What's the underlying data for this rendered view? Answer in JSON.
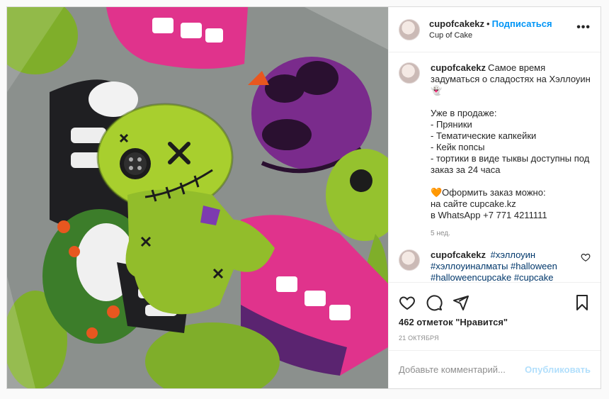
{
  "header": {
    "username": "cupofcakekz",
    "separator": "•",
    "follow_label": "Подписаться",
    "subtitle": "Cup of Cake",
    "more_icon": "more-horizontal-icon"
  },
  "caption": {
    "username": "cupofcakekz",
    "lines": [
      "Самое время задуматься о сладостях на Хэллоуин 👻",
      "",
      "Уже в продаже:",
      "- Пряники",
      "- Тематические капкейки",
      "- Кейк попсы",
      "- тортики в виде тыквы доступны под заказ за 24 часа",
      "",
      "🧡Оформить заказ можно:",
      "на сайте cupcake.kz",
      "в WhatsApp +7 771 4211111"
    ],
    "age": "5 нед."
  },
  "comment": {
    "username": "cupofcakekz",
    "hashtags": [
      "#хэллоуин",
      "#хэллоуиналматы",
      "#halloween",
      "#halloweencupcake",
      "#cupcake"
    ]
  },
  "actions": {
    "like_icon": "heart-icon",
    "comment_icon": "comment-icon",
    "share_icon": "share-icon",
    "save_icon": "bookmark-icon"
  },
  "likes_text": "462 отметок \"Нравится\"",
  "date_text": "21 ОКТЯБРЯ",
  "add_comment": {
    "placeholder": "Добавьте комментарий...",
    "post_label": "Опубликовать"
  },
  "colors": {
    "follow": "#0095f6",
    "hashtag": "#00376b",
    "post_disabled": "#b2dffc",
    "muted": "#8e8e8e"
  }
}
